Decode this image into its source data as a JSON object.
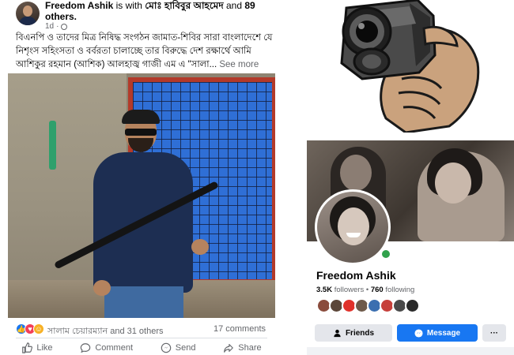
{
  "post": {
    "author": "Freedom Ashik",
    "with_text": "is with",
    "tagged_name": "মোঃ হাবিবুর আহমেদ",
    "and_text": "and",
    "others": "89 others.",
    "time": "1d",
    "body": "বিএনপি ও তাদের মিত্র নিষিদ্ধ সংগঠন জামাত-শিবির সারা বাংলাদেশে যে নিশৃংস সহিংসতা ও বর্বরতা চালাচ্ছে তার বিরুদ্ধে দেশ রক্ষার্থে আমি আশিকুর রহমান (আশিক) আলহাজ্ব গাজী এম এ \"সালা...",
    "see_more": "See more",
    "reactions_text": "সালাম চেয়ারম্যান and 31 others",
    "comments_count": "17 comments",
    "actions": {
      "like": "Like",
      "comment": "Comment",
      "send": "Send",
      "share": "Share"
    }
  },
  "profile": {
    "name": "Freedom Ashik",
    "followers": "3.5K",
    "followers_label": "followers",
    "separator": "•",
    "following": "760",
    "following_label": "following",
    "friend_avatar_colors": [
      "#8a4b3c",
      "#5b4638",
      "#e0312a",
      "#6e5a4a",
      "#3b6fb0",
      "#c6403a",
      "#4a4a4a",
      "#2a2a2a"
    ],
    "buttons": {
      "friends": "Friends",
      "message": "Message",
      "more": "···"
    },
    "accent": "#1877f2",
    "online_color": "#31a24c"
  }
}
